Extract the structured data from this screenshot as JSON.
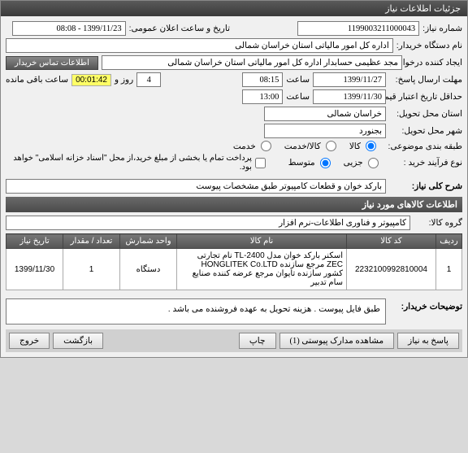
{
  "window_title": "جزئیات اطلاعات نیاز",
  "header": {
    "req_number_label": "شماره نیاز:",
    "req_number": "1199003211000043",
    "announce_label": "تاریخ و ساعت اعلان عمومی:",
    "announce_value": "1399/11/23 - 08:08",
    "buyer_label": "نام دستگاه خریدار:",
    "buyer_value": "اداره کل امور مالیاتی استان خراسان شمالی",
    "creator_label": "ایجاد کننده درخواست:",
    "creator_value": "مجد عظیمی حسابدار اداره کل امور مالیاتی استان خراسان شمالی",
    "contact_tab": "اطلاعات تماس خریدار"
  },
  "dates": {
    "reply_deadline_label": "مهلت ارسال پاسخ:",
    "reply_date": "1399/11/27",
    "reply_time_label": "ساعت",
    "reply_time": "08:15",
    "days_count": "4",
    "days_label": "روز و",
    "timer": "00:01:42",
    "remaining_label": "ساعت باقی مانده",
    "validity_label": "حداقل تاریخ اعتبار قیمت: تا تاریخ:",
    "validity_date": "1399/11/30",
    "validity_time_label": "ساعت",
    "validity_time": "13:00",
    "delivery_province_label": "استان محل تحویل:",
    "delivery_province": "خراسان شمالی",
    "delivery_city_label": "شهر محل تحویل:",
    "delivery_city": "بجنورد"
  },
  "classification": {
    "class_label": "طبقه بندی موضوعی:",
    "opt_goods": "کالا",
    "opt_service": "کالا/خدمت",
    "opt_serviceonly": "خدمت",
    "purchase_type_label": "نوع فرآیند خرید :",
    "opt_minor": "جزیی",
    "opt_medium": "متوسط",
    "partial_pay_label": "پرداخت تمام یا بخشی از مبلغ خرید،از محل \"اسناد خزانه اسلامی\" خواهد بود."
  },
  "need": {
    "title_label": "شرح کلی نیاز:",
    "title_value": "بارکد خوان و قطعات کامپیوتر طبق مشخصات پیوست"
  },
  "items_section": "اطلاعات کالاهای مورد نیاز",
  "group": {
    "label": "گروه کالا:",
    "value": "کامپیوتر و فناوری اطلاعات-نرم افزار"
  },
  "table": {
    "headers": {
      "row": "ردیف",
      "code": "کد کالا",
      "name": "نام کالا",
      "unit": "واحد شمارش",
      "qty": "تعداد / مقدار",
      "date": "تاریخ نیاز"
    },
    "rows": [
      {
        "row": "1",
        "code": "2232100992810004",
        "name": "اسکنر بارکد خوان مدل TL-2400 نام تجارتی ZEC مرجع سازنده HONGLITEK Co.LTD کشور سازنده تایوان مرجع عرضه کننده صنایع سام تدبیر",
        "unit": "دستگاه",
        "qty": "1",
        "date": "1399/11/30"
      }
    ]
  },
  "buyer_notes": {
    "label": "توضیحات خریدار:",
    "text": "طبق فایل پیوست . هزینه تحویل به عهده فروشنده می باشد ."
  },
  "footer": {
    "reply_btn": "پاسخ به نیاز",
    "attachments_btn": "مشاهده مدارک پیوستی (1)",
    "print_btn": "چاپ",
    "back_btn": "بازگشت",
    "exit_btn": "خروج"
  }
}
